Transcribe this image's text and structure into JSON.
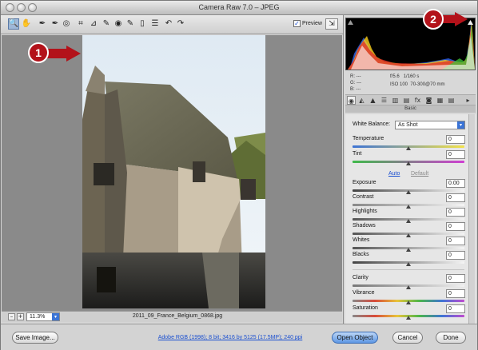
{
  "window": {
    "title": "Camera Raw 7.0  –  JPEG"
  },
  "toolbar": {
    "tools": [
      "zoom-tool",
      "hand-tool",
      "white-balance-tool",
      "color-sampler-tool",
      "target-adjustment-tool",
      "crop-tool",
      "straighten-tool",
      "spot-removal-tool",
      "red-eye-tool",
      "adjustment-brush-tool",
      "graduated-filter-tool",
      "preferences-tool",
      "rotate-ccw-tool",
      "rotate-cw-tool"
    ],
    "tool_glyphs": [
      "🔍",
      "✋",
      "✒",
      "✒",
      "◎",
      "⌗",
      "⊿",
      "✎",
      "◉",
      "✎",
      "▯",
      "☰",
      "↶",
      "↷"
    ],
    "preview_label": "Preview",
    "preview_checked_glyph": "✓",
    "fullscreen_glyph": "⇲"
  },
  "status": {
    "zoom_minus": "–",
    "zoom_plus": "+",
    "zoom_value": "11.3%",
    "filename": "2011_09_France_Belgium_0868.jpg"
  },
  "readout": {
    "r_line": "R:  ---",
    "g_line": "G:  ---",
    "b_line": "B:  ---",
    "aperture": "f/5.6",
    "shutter": "1/160 s",
    "iso": "ISO 100",
    "lens": "70-300@70 mm"
  },
  "tabs": [
    "◉",
    "◭",
    "▲",
    "☰",
    "▥",
    "▤",
    "fx",
    "◙",
    "▦",
    "▤"
  ],
  "panel": {
    "section_title": "Basic",
    "white_balance_label": "White Balance:",
    "white_balance_value": "As Shot",
    "temperature_label": "Temperature",
    "temperature_value": "0",
    "tint_label": "Tint",
    "tint_value": "0",
    "auto_label": "Auto",
    "default_label": "Default",
    "exposure_label": "Exposure",
    "exposure_value": "0.00",
    "contrast_label": "Contrast",
    "contrast_value": "0",
    "highlights_label": "Highlights",
    "highlights_value": "0",
    "shadows_label": "Shadows",
    "shadows_value": "0",
    "whites_label": "Whites",
    "whites_value": "0",
    "blacks_label": "Blacks",
    "blacks_value": "0",
    "clarity_label": "Clarity",
    "clarity_value": "0",
    "vibrance_label": "Vibrance",
    "vibrance_value": "0",
    "saturation_label": "Saturation",
    "saturation_value": "0"
  },
  "bottom": {
    "save_label": "Save Image...",
    "workflow_link": "Adobe RGB (1998); 8 bit; 3416 by 5125 (17.5MP); 240 ppi",
    "open_label": "Open Object",
    "cancel_label": "Cancel",
    "done_label": "Done"
  },
  "callouts": {
    "one": "1",
    "two": "2"
  },
  "colors": {
    "accent": "#3b74d6",
    "callout": "#b3121a",
    "canvas": "#8a8a8a"
  }
}
